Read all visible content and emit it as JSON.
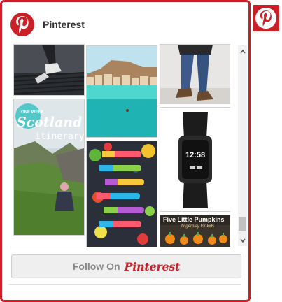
{
  "widget": {
    "title": "Pinterest",
    "follow_button": {
      "label": "Follow On",
      "brand": "Pinterest"
    }
  },
  "pins": [
    {
      "name": "shoes-on-grate",
      "caption": ""
    },
    {
      "name": "coastal-town",
      "caption": ""
    },
    {
      "name": "jeans-boots",
      "caption": ""
    },
    {
      "name": "scotland-itinerary",
      "badge": "ONE WEEK",
      "title": "Scotland",
      "subtitle": "itinerary"
    },
    {
      "name": "fitness-tracker",
      "watch_time": "12:58"
    },
    {
      "name": "fruit-popsicles",
      "caption": ""
    },
    {
      "name": "pumpkins",
      "title": "Five Little Pumpkins",
      "subtitle": "fingerplay for kids"
    }
  ],
  "colors": {
    "brand": "#cb2027"
  }
}
